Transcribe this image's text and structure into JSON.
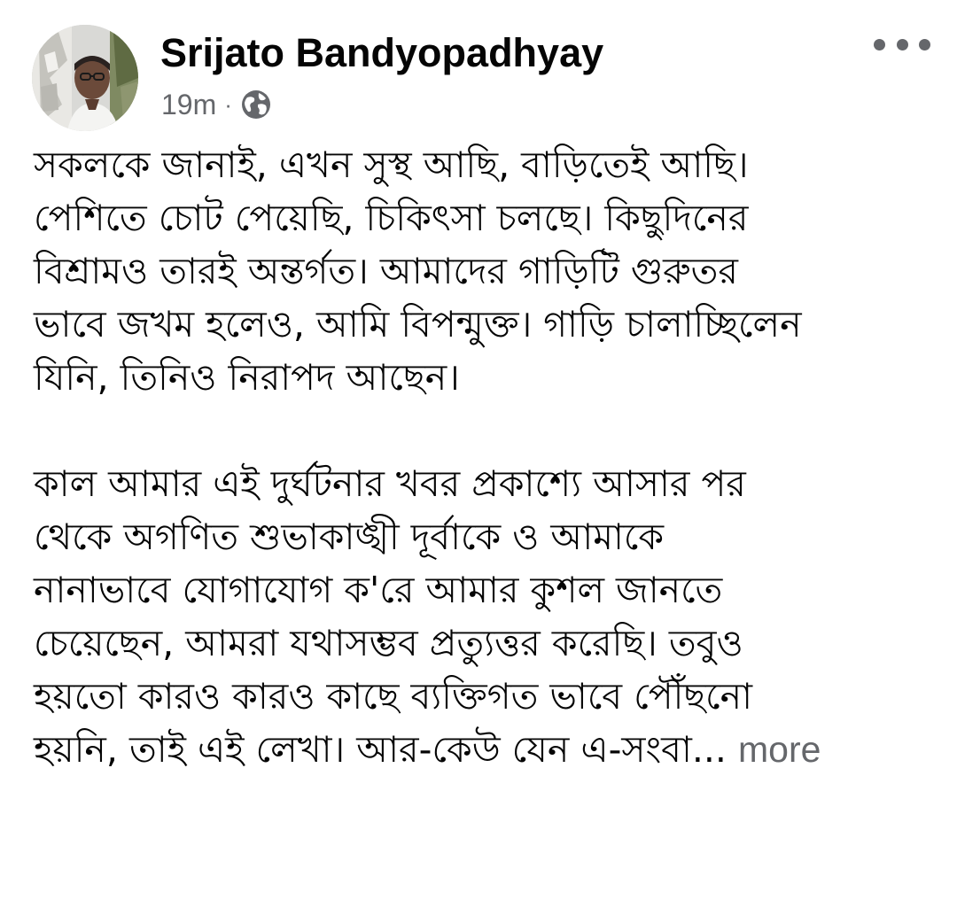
{
  "post": {
    "author": {
      "name": "Srijato Bandyopadhyay",
      "avatar_icon": "profile-photo"
    },
    "timestamp": "19m",
    "separator": "·",
    "audience_icon": "globe-icon",
    "menu_icon": "more-options-icon",
    "paragraphs": [
      [
        "সকলকে জানাই, এখন সুস্থ আছি, বাড়িতেই আছি।",
        "পেশিতে চোট পেয়েছি, চিকিৎসা চলছে। কিছুদিনের",
        "বিশ্রামও তারই অন্তর্গত। আমাদের গাড়িটি গুরুতর",
        "ভাবে জখম হলেও, আমি বিপন্মুক্ত। গাড়ি চালাচ্ছিলেন",
        "যিনি, তিনিও নিরাপদ আছেন।"
      ],
      [
        "কাল আমার এই দুর্ঘটনার খবর প্রকাশ্যে আসার পর",
        "থেকে অগণিত শুভাকাঙ্খী দূর্বাকে ও আমাকে",
        "নানাভাবে যোগাযোগ ক'রে আমার কুশল জানতে",
        "চেয়েছেন, আমরা যথাসম্ভব প্রত্যুত্তর করেছি। তবুও",
        "হয়তো কারও কারও কাছে ব্যক্তিগত ভাবে পৌঁছনো",
        "হয়নি, তাই এই লেখা। আর-কেউ যেন এ-সংবা..."
      ]
    ],
    "see_more_label": "more"
  },
  "colors": {
    "text": "#050505",
    "secondary": "#65676b",
    "background": "#ffffff"
  }
}
